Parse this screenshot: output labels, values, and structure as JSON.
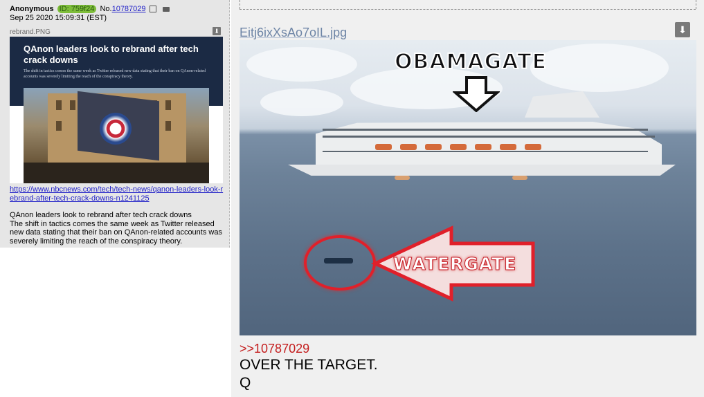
{
  "post_left": {
    "name": "Anonymous",
    "id_label": "ID: 759f24",
    "no_prefix": "No.",
    "post_number": "10787029",
    "date": "Sep 25 2020 15:09:31 (EST)",
    "file_name": "rebrand.PNG",
    "thumb": {
      "headline": "QAnon leaders look to rebrand after tech crack downs",
      "subhead": "The shift in tactics comes the same week as Twitter released new data stating that their ban on QAnon-related accounts was severely limiting the reach of the conspiracy theory."
    },
    "link": "https://www.nbcnews.com/tech/tech-news/qanon-leaders-look-rebrand-after-tech-crack-downs-n1241125",
    "body_lines": [
      "QAnon leaders look to rebrand after tech crack downs",
      "The shift in tactics comes the same week as Twitter released new data stating that their ban on QAnon-related accounts was severely limiting the reach of the conspiracy theory."
    ]
  },
  "post_right": {
    "file_name": "Eitj6ixXsAo7oIL.jpg",
    "image_text_top": "OBAMAGATE",
    "image_text_arrow": "WATERGATE",
    "reply_link": ">>10787029",
    "lines": [
      "OVER THE TARGET.",
      "Q"
    ]
  },
  "icons": {
    "download": "download-icon",
    "external_link": "external-link-icon",
    "folder": "folder-icon"
  },
  "colors": {
    "post_bg": "#e6e6e6",
    "id_badge": "#7ebd3a",
    "link": "#2323c8",
    "reply": "#c41e1e",
    "file_link": "#6e85a6",
    "banner": "#1b2a44"
  }
}
